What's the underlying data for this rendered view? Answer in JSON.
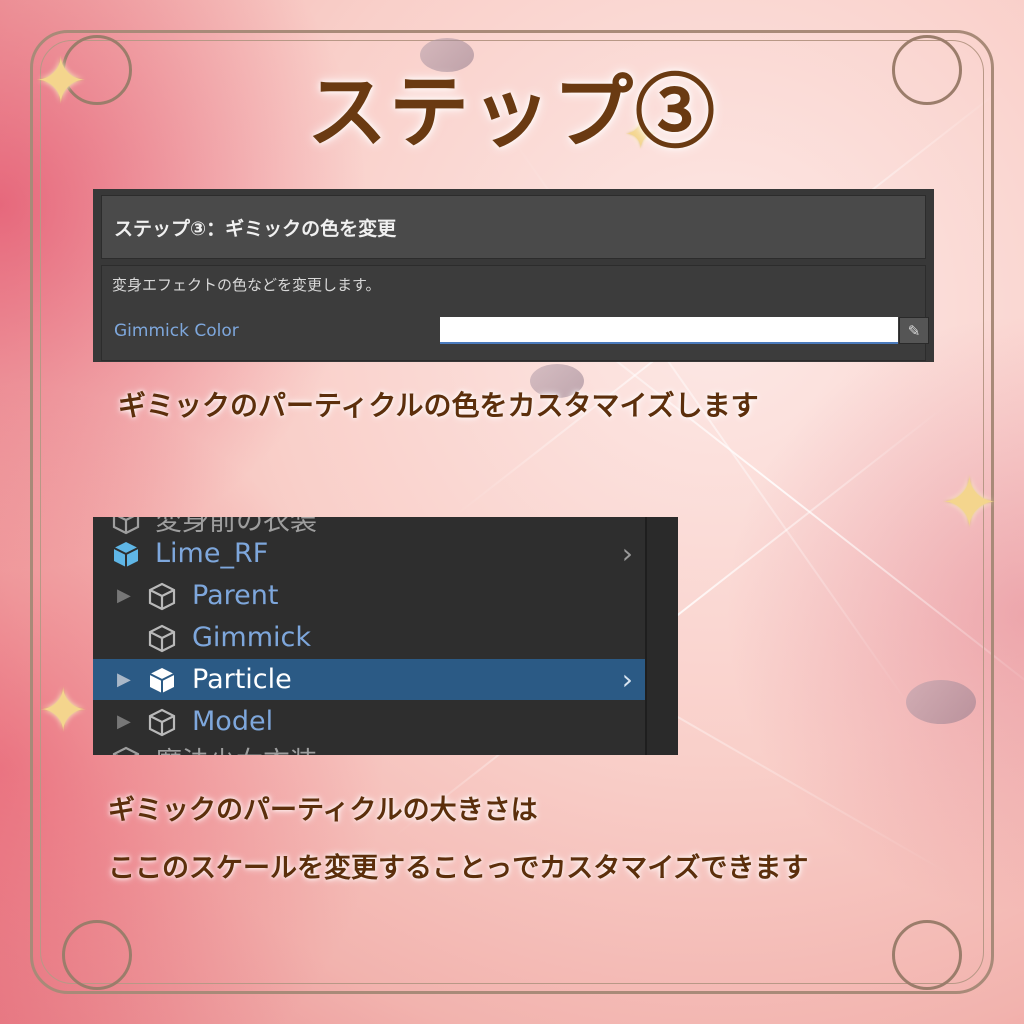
{
  "title": "ステップ③",
  "inspector": {
    "header": "ステップ③：ギミックの色を変更",
    "description": "変身エフェクトの色などを変更します。",
    "field_label": "Gimmick Color",
    "field_value_color": "#ffffff"
  },
  "caption1": "ギミックのパーティクルの色をカスタマイズします",
  "hierarchy": {
    "top_cut": "変身前の衣装",
    "items": [
      {
        "label": "Lime_RF",
        "selected": false
      },
      {
        "label": "Parent",
        "selected": false
      },
      {
        "label": "Gimmick",
        "selected": false
      },
      {
        "label": "Particle",
        "selected": true
      },
      {
        "label": "Model",
        "selected": false
      }
    ],
    "bottom_cut": "魔法少女衣装"
  },
  "caption2": "ギミックのパーティクルの大きさは",
  "caption3": "ここのスケールを変更することっでカスタマイズできます",
  "colors": {
    "title": "#6a3a12",
    "panel_bg": "#383838",
    "selection": "#2b5a85",
    "label_blue": "#7ea7dc"
  }
}
